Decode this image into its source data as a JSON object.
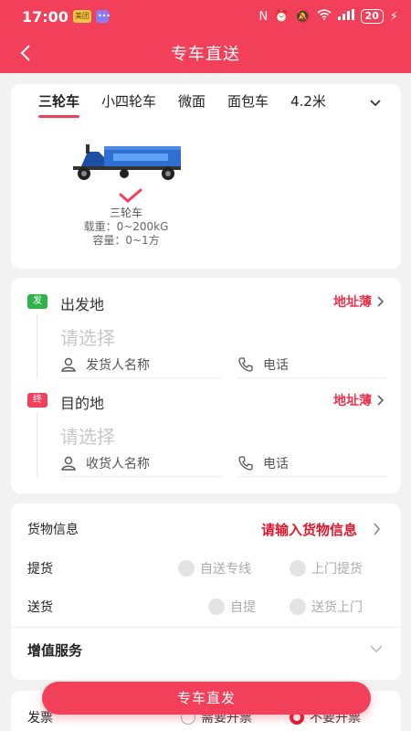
{
  "status_bar": {
    "time": "17:00",
    "badge_app": "美团",
    "battery": "20"
  },
  "nav": {
    "title": "专车直送"
  },
  "vehicle": {
    "tabs": [
      "三轮车",
      "小四轮车",
      "微面",
      "面包车",
      "4.2米"
    ],
    "active_index": 0,
    "selected": {
      "name": "三轮车",
      "load": "载重：0~200kG",
      "volume": "容量：0~1方"
    }
  },
  "address": {
    "origin": {
      "tag": "发",
      "title": "出发地",
      "address_book": "地址薄",
      "placeholder": "请选择",
      "contact_placeholder": "发货人名称",
      "phone_placeholder": "电话"
    },
    "destination": {
      "tag": "终",
      "title": "目的地",
      "address_book": "地址薄",
      "placeholder": "请选择",
      "contact_placeholder": "收货人名称",
      "phone_placeholder": "电话"
    }
  },
  "goods": {
    "info_label": "货物信息",
    "info_prompt": "请输入货物信息",
    "pickup_label": "提货",
    "pickup_options": [
      "自送专线",
      "上门提货"
    ],
    "delivery_label": "送货",
    "delivery_options": [
      "自提",
      "送货上门"
    ],
    "value_added_label": "增值服务"
  },
  "invoice": {
    "label": "发票",
    "options": [
      "需要开票",
      "不要开票"
    ],
    "selected_index": 1
  },
  "submit": {
    "label": "专车直发"
  },
  "colors": {
    "brand": "#f23f5a",
    "accent_text": "#e0182f",
    "origin_tag": "#2fb24c"
  }
}
